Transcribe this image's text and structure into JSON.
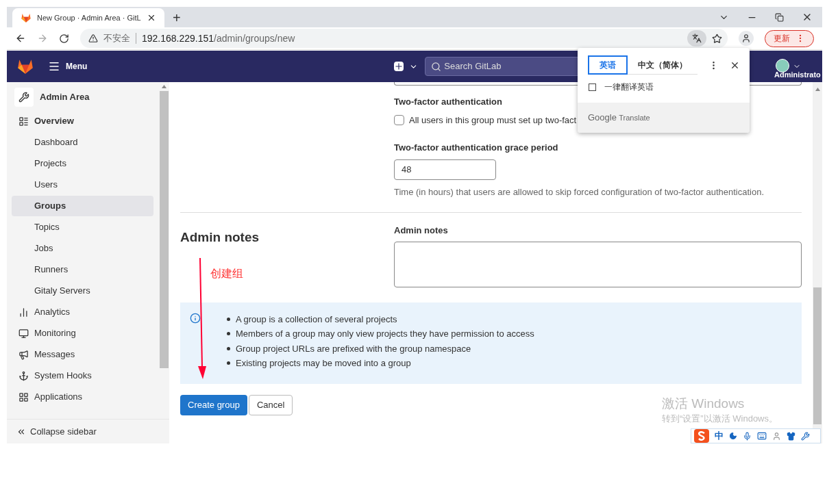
{
  "browser": {
    "tab_title": "New Group · Admin Area · GitL",
    "new_tab": "+",
    "security": "不安全",
    "url_host": "192.168.229.151",
    "url_path": "/admin/groups/new",
    "update_button": "更新"
  },
  "header": {
    "menu": "Menu",
    "search_placeholder": "Search GitLab",
    "user": "Administrato"
  },
  "sidebar": {
    "title": "Admin Area",
    "items": [
      {
        "label": "Overview",
        "kind": "section",
        "selected": false
      },
      {
        "label": "Dashboard",
        "kind": "sub",
        "selected": false
      },
      {
        "label": "Projects",
        "kind": "sub",
        "selected": false
      },
      {
        "label": "Users",
        "kind": "sub",
        "selected": false
      },
      {
        "label": "Groups",
        "kind": "sub",
        "selected": true
      },
      {
        "label": "Topics",
        "kind": "sub",
        "selected": false
      },
      {
        "label": "Jobs",
        "kind": "sub",
        "selected": false
      },
      {
        "label": "Runners",
        "kind": "sub",
        "selected": false
      },
      {
        "label": "Gitaly Servers",
        "kind": "sub",
        "selected": false
      },
      {
        "label": "Analytics",
        "kind": "section",
        "selected": false
      },
      {
        "label": "Monitoring",
        "kind": "section",
        "selected": false
      },
      {
        "label": "Messages",
        "kind": "section",
        "selected": false
      },
      {
        "label": "System Hooks",
        "kind": "section",
        "selected": false
      },
      {
        "label": "Applications",
        "kind": "section",
        "selected": false
      }
    ],
    "collapse": "Collapse sidebar"
  },
  "form": {
    "two_factor_label": "Two-factor authentication",
    "two_factor_checkbox": {
      "label": "All users in this group must set up two-fact",
      "checked": false
    },
    "grace_label": "Two-factor authentication grace period",
    "grace_value": "48",
    "grace_help": "Time (in hours) that users are allowed to skip forced configuration of two-factor authentication.",
    "admin_notes_heading": "Admin notes",
    "admin_notes_label": "Admin notes"
  },
  "annotation": "创建组",
  "info": [
    "A group is a collection of several projects",
    "Members of a group may only view projects they have permission to access",
    "Group project URLs are prefixed with the group namespace",
    "Existing projects may be moved into a group"
  ],
  "buttons": {
    "create": "Create group",
    "cancel": "Cancel"
  },
  "translate_popup": {
    "languages": [
      {
        "label": "英语",
        "selected": true
      },
      {
        "label": "中文（简体）",
        "selected": false
      }
    ],
    "always": {
      "label": "一律翻译英语",
      "checked": false
    },
    "brand": "Google",
    "product": "Translate"
  },
  "os_overlay": {
    "title": "激活 Windows",
    "subtitle": "转到“设置”以激活 Windows。"
  },
  "ime": {
    "mode": "中"
  }
}
